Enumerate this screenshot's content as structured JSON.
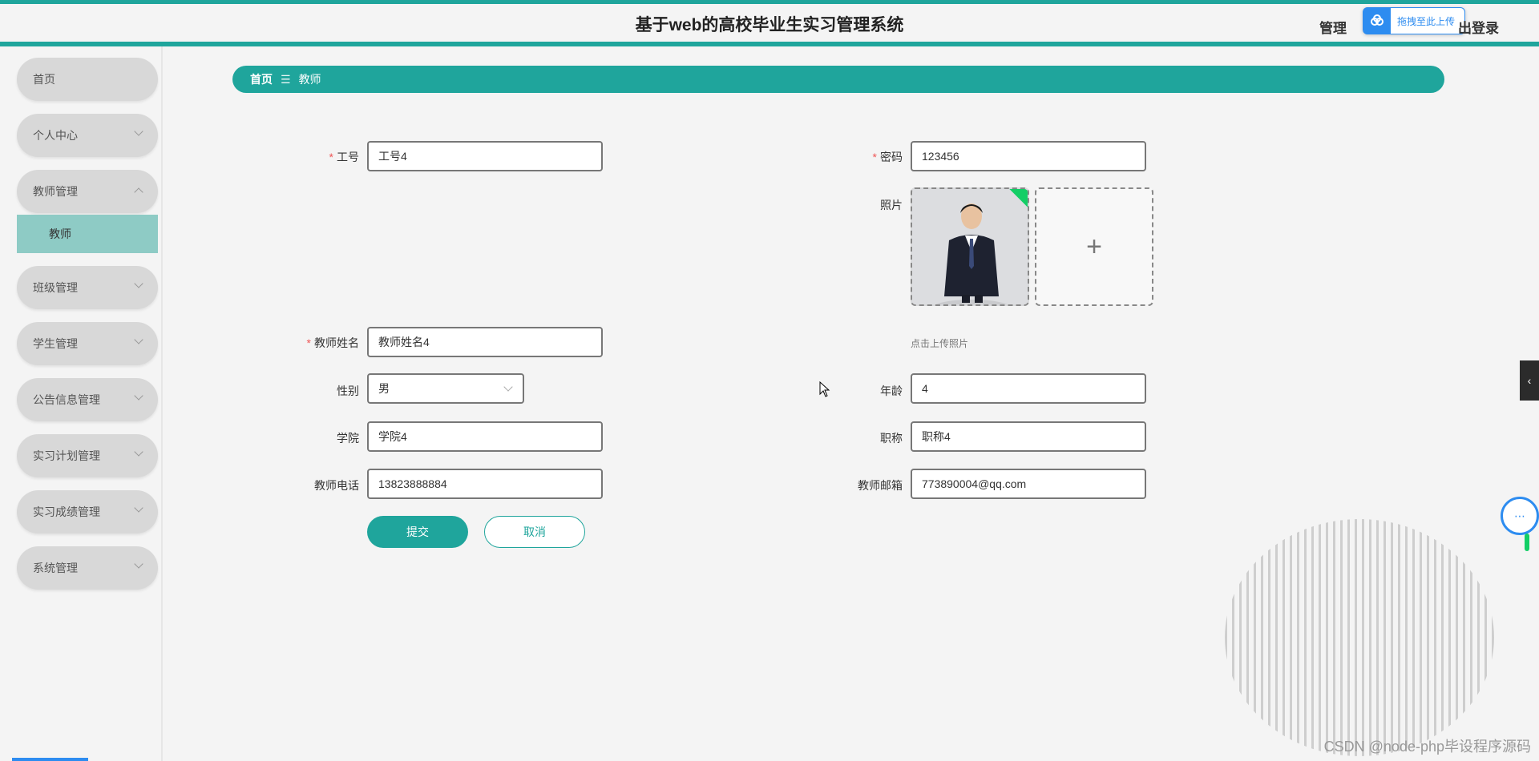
{
  "header": {
    "title": "基于web的高校毕业生实习管理系统",
    "admin_text": "管理",
    "logout_text": "出登录",
    "upload_label": "拖拽至此上传"
  },
  "sidebar": {
    "items": [
      {
        "label": "首页"
      },
      {
        "label": "个人中心"
      },
      {
        "label": "教师管理"
      },
      {
        "label": "班级管理"
      },
      {
        "label": "学生管理"
      },
      {
        "label": "公告信息管理"
      },
      {
        "label": "实习计划管理"
      },
      {
        "label": "实习成绩管理"
      },
      {
        "label": "系统管理"
      }
    ],
    "active_sub": "教师"
  },
  "breadcrumb": {
    "home": "首页",
    "separator": "☰",
    "current": "教师"
  },
  "form": {
    "job_no": {
      "label": "工号",
      "value": "工号4"
    },
    "password": {
      "label": "密码",
      "value": "123456"
    },
    "photo": {
      "label": "照片",
      "hint": "点击上传照片",
      "add": "+"
    },
    "teacher_name": {
      "label": "教师姓名",
      "value": "教师姓名4"
    },
    "gender": {
      "label": "性别",
      "value": "男"
    },
    "age": {
      "label": "年龄",
      "value": "4"
    },
    "college": {
      "label": "学院",
      "value": "学院4"
    },
    "title": {
      "label": "职称",
      "value": "职称4"
    },
    "phone": {
      "label": "教师电话",
      "value": "13823888884"
    },
    "email": {
      "label": "教师邮箱",
      "value": "773890004@qq.com"
    },
    "required_mark": "*",
    "submit": "提交",
    "cancel": "取消"
  },
  "watermark": "CSDN @node-php毕设程序源码",
  "colors": {
    "accent": "#1fa59c",
    "sidebar_active": "#8ecbc5",
    "upload_blue": "#2d8cf0"
  }
}
